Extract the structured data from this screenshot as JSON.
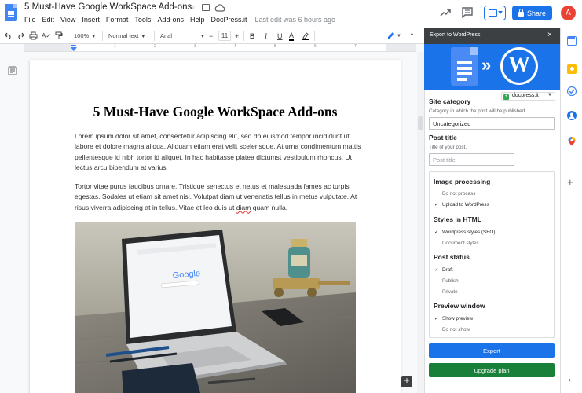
{
  "doc": {
    "title": "5 Must-Have Google WorkSpace Add-ons",
    "menu": [
      "File",
      "Edit",
      "View",
      "Insert",
      "Format",
      "Tools",
      "Add-ons",
      "Help",
      "DocPress.it"
    ],
    "last_edit": "Last edit was 6 hours ago"
  },
  "header": {
    "share_label": "Share",
    "avatar_letter": "A"
  },
  "toolbar": {
    "zoom": "100%",
    "style": "Normal text",
    "font": "Arial",
    "font_size": "11",
    "bold": "B",
    "italic": "I",
    "underline": "U",
    "text_color": "A",
    "minus": "−",
    "plus": "+"
  },
  "ruler": {
    "labels": [
      "1",
      "2",
      "3",
      "4",
      "5",
      "6",
      "7"
    ]
  },
  "content": {
    "heading": "5 Must-Have Google WorkSpace Add-ons",
    "p1": "Lorem ipsum dolor sit amet, consectetur adipiscing elit, sed do eiusmod tempor incididunt ut labore et dolore magna aliqua. Aliquam etiam erat velit scelerisque. At urna condimentum mattis pellentesque id nibh tortor id aliquet. In hac habitasse platea dictumst vestibulum rhoncus. Ut lectus arcu bibendum at varius.",
    "p2_a": "Tortor vitae purus faucibus ornare. Tristique senectus et netus et malesuada fames ac turpis egestas. Sodales ut etiam sit amet nisl. Volutpat diam ut venenatis tellus in metus vulputate. At risus viverra adipiscing at in tellus. Vitae et leo duis ut ",
    "p2_spell": "diam",
    "p2_b": " quam nulla.",
    "photo_logo": "Google"
  },
  "panel": {
    "title": "Export to WordPress",
    "close": "×",
    "docpress_label": "docpress.it",
    "category": {
      "title": "Site category",
      "sub": "Category in which the post will be published.",
      "value": "Uncategorized"
    },
    "post_title": {
      "title": "Post title",
      "sub": "Title of your post.",
      "placeholder": "Post title"
    },
    "image_processing": {
      "title": "Image processing",
      "opt_off": "Do not process",
      "opt_on": "Upload to WordPress"
    },
    "styles": {
      "title": "Styles in HTML",
      "opt_on": "Wordpress styles (SEO)",
      "opt_off": "Document styles"
    },
    "post_status": {
      "title": "Post status",
      "opt_on": "Draft",
      "opt_off1": "Publish",
      "opt_off2": "Private"
    },
    "preview": {
      "title": "Preview window",
      "opt_on": "Show preview",
      "opt_off": "Do not show"
    },
    "check": "✓",
    "export_label": "Export",
    "upgrade_label": "Upgrade plan"
  },
  "colors": {
    "accent_blue": "#1a73e8",
    "upgrade_green": "#188038",
    "panel_header": "#3c4043"
  }
}
